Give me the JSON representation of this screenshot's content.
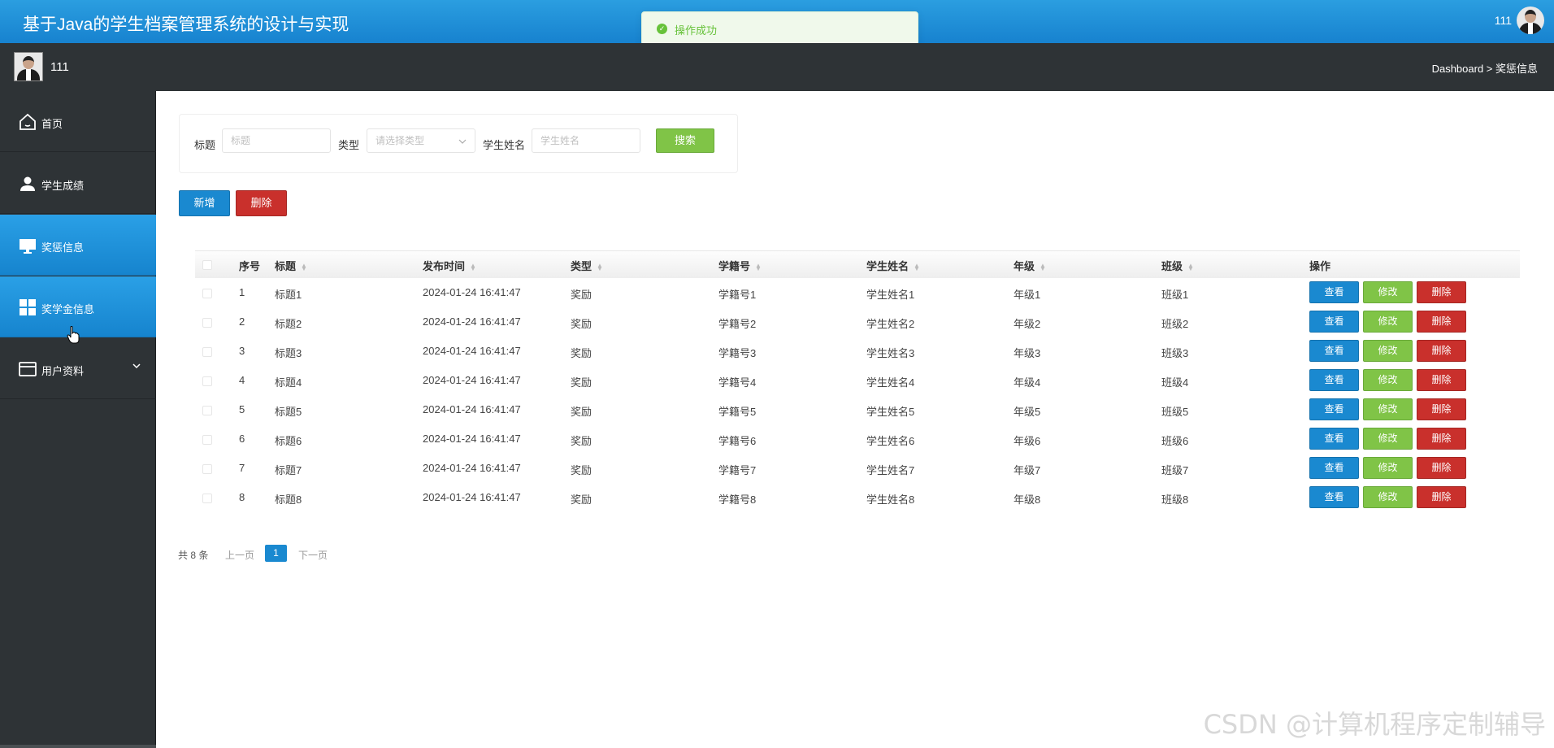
{
  "app": {
    "title": "基于Java的学生档案管理系统的设计与实现",
    "top_user": "111",
    "sub_user": "111",
    "breadcrumb": "Dashboard > 奖惩信息"
  },
  "toast": {
    "text": "操作成功",
    "color": "#67c23a"
  },
  "sidebar": {
    "items": [
      {
        "label": "首页",
        "icon": "home-icon",
        "active": false
      },
      {
        "label": "学生成绩",
        "icon": "user-icon",
        "active": false
      },
      {
        "label": "奖惩信息",
        "icon": "monitor-icon",
        "active": true
      },
      {
        "label": "奖学金信息",
        "icon": "grid-icon",
        "active": true
      },
      {
        "label": "用户资料",
        "icon": "card-icon",
        "active": false,
        "has_submenu": true
      }
    ]
  },
  "search": {
    "title_label": "标题",
    "title_placeholder": "标题",
    "type_label": "类型",
    "type_placeholder": "请选择类型",
    "name_label": "学生姓名",
    "name_placeholder": "学生姓名",
    "search_button": "搜索"
  },
  "toolbar": {
    "add_label": "新增",
    "delete_label": "删除"
  },
  "table": {
    "headers": [
      "序号",
      "标题",
      "发布时间",
      "类型",
      "学籍号",
      "学生姓名",
      "年级",
      "班级",
      "操作"
    ],
    "rows": [
      [
        "1",
        "标题1",
        "2024-01-24 16:41:47",
        "奖励",
        "学籍号1",
        "学生姓名1",
        "年级1",
        "班级1"
      ],
      [
        "2",
        "标题2",
        "2024-01-24 16:41:47",
        "奖励",
        "学籍号2",
        "学生姓名2",
        "年级2",
        "班级2"
      ],
      [
        "3",
        "标题3",
        "2024-01-24 16:41:47",
        "奖励",
        "学籍号3",
        "学生姓名3",
        "年级3",
        "班级3"
      ],
      [
        "4",
        "标题4",
        "2024-01-24 16:41:47",
        "奖励",
        "学籍号4",
        "学生姓名4",
        "年级4",
        "班级4"
      ],
      [
        "5",
        "标题5",
        "2024-01-24 16:41:47",
        "奖励",
        "学籍号5",
        "学生姓名5",
        "年级5",
        "班级5"
      ],
      [
        "6",
        "标题6",
        "2024-01-24 16:41:47",
        "奖励",
        "学籍号6",
        "学生姓名6",
        "年级6",
        "班级6"
      ],
      [
        "7",
        "标题7",
        "2024-01-24 16:41:47",
        "奖励",
        "学籍号7",
        "学生姓名7",
        "年级7",
        "班级7"
      ],
      [
        "8",
        "标题8",
        "2024-01-24 16:41:47",
        "奖励",
        "学籍号8",
        "学生姓名8",
        "年级8",
        "班级8"
      ]
    ],
    "row_actions": {
      "view": "查看",
      "edit": "修改",
      "delete": "删除"
    }
  },
  "pager": {
    "total": "共 8 条",
    "prev": "上一页",
    "current": "1",
    "next": "下一页"
  },
  "watermark": "CSDN @计算机程序定制辅导",
  "colors": {
    "header_blue": "#1a89d0",
    "dark_bg": "#2e3336",
    "green": "#80c447",
    "red": "#c9302c"
  }
}
